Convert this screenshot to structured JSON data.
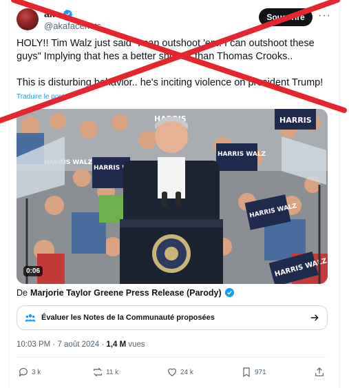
{
  "colors": {
    "accent": "#1d9bf0",
    "text": "#0f1419",
    "muted": "#536471",
    "cross": "#e3262f"
  },
  "author": {
    "name": "aka",
    "handle": "@akafacehots",
    "avatar": "avatar-photo"
  },
  "header": {
    "subscribe_label": "Souscrire",
    "more_label": "···"
  },
  "tweet": {
    "text_1": "HOLY!! Tim Walz just said \"I can outshoot 'em. I can outshoot these guys\" Implying that hes a better shooter than Thomas Crooks..",
    "text_2": "This is disturbing behavior.. he's inciting violence on president Trump!",
    "translate_label": "Traduire le post"
  },
  "media": {
    "timecode": "0:06",
    "signs": [
      "HARRIS",
      "HARRIS",
      "HARRIS WALZ",
      "HARRIS WALZ",
      "HARRIS WALZ",
      "HARRIS WALZ",
      "HARRIS WALZ"
    ]
  },
  "source": {
    "prefix": "De",
    "account": "Marjorie Taylor Greene Press Release (Parody)"
  },
  "community_notes": {
    "label": "Évaluer les Notes de la Communauté proposées"
  },
  "meta": {
    "timestamp": "10:03 PM · 7 août 2024 · ",
    "views": "1,4 M",
    "views_label": " vues"
  },
  "actions": {
    "replies": "3 k",
    "reposts": "11 k",
    "likes": "24 k",
    "bookmarks": "971"
  }
}
